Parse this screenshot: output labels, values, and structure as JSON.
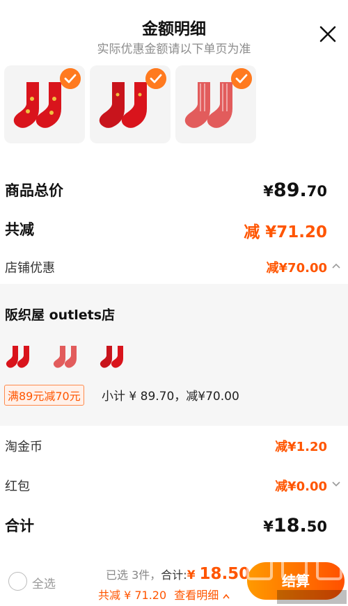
{
  "header": {
    "title": "金额明细",
    "subtitle": "实际优惠金额请以下单页为准"
  },
  "products": [
    {
      "name": "red-socks-gold-pattern"
    },
    {
      "name": "red-socks-plain"
    },
    {
      "name": "pink-striped-socks"
    }
  ],
  "summary": {
    "total_label": "商品总价",
    "total_symbol": "¥",
    "total_int": "89.",
    "total_dec": "70",
    "discount_label": "共减",
    "discount_value": "减 ¥71.20",
    "shop_label": "店铺优惠",
    "shop_value": "减¥70.00"
  },
  "shop": {
    "name": "阪织屋 outlets店",
    "coupon": "满89元减70元",
    "subtotal": "小计 ¥ 89.70，减¥70.00"
  },
  "other": {
    "coin_label": "淘金币",
    "coin_value": "减¥1.20",
    "redpack_label": "红包",
    "redpack_value": "减¥0.00",
    "grand_label": "合计",
    "grand_symbol": "¥",
    "grand_int": "18.",
    "grand_dec": "50"
  },
  "bottom_bar": {
    "select_all": "全选",
    "selected_text": "已选 3件，",
    "total_label": "合计:",
    "total_symbol": "¥ ",
    "total_amount": "18.50",
    "discount_text": "共减 ¥ 71.20",
    "detail_link": "查看明细",
    "pay_button": "结算",
    "watermark": "值 什么值得买"
  },
  "colors": {
    "accent": "#ff5500",
    "check": "#ff7a1f",
    "sock_red": "#d9141c",
    "sock_pink": "#e25c5c"
  }
}
